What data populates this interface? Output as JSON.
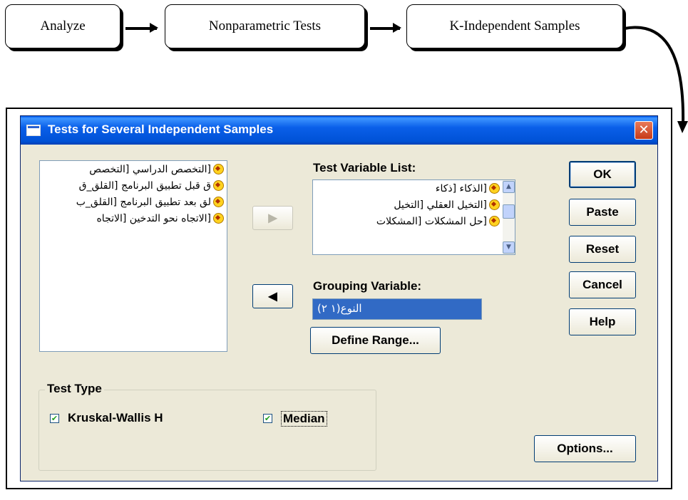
{
  "flow": {
    "steps": [
      "Analyze",
      "Nonparametric Tests",
      "K-Independent Samples"
    ]
  },
  "dialog": {
    "title": "Tests for Several Independent Samples",
    "close_glyph": "✕",
    "source_list": [
      "[التخصص الدراسي [التخصص",
      "ق قبل تطبيق البرنامج [القلق_ق",
      "لق بعد تطبيق البرنامج [القلق_ب",
      "[الاتجاه نحو التدخين [الاتجاه"
    ],
    "move_right_glyph": "▶",
    "move_left_glyph": "◀",
    "test_variable_label": "Test Variable List:",
    "test_variables": [
      "[الذكاء [ذكاء",
      "[التخيل العقلي [التخيل",
      "[حل المشكلات [المشكلات"
    ],
    "grouping_label": "Grouping Variable:",
    "grouping_value": "النوع(١ ٢)",
    "define_range_label": "Define Range...",
    "buttons": {
      "ok": "OK",
      "paste": "Paste",
      "reset": "Reset",
      "cancel": "Cancel",
      "help": "Help",
      "options": "Options..."
    },
    "test_type": {
      "legend": "Test Type",
      "kruskal_label": "Kruskal-Wallis H",
      "kruskal_checked": true,
      "median_label": "Median",
      "median_checked": true,
      "check_glyph": "✔"
    }
  }
}
